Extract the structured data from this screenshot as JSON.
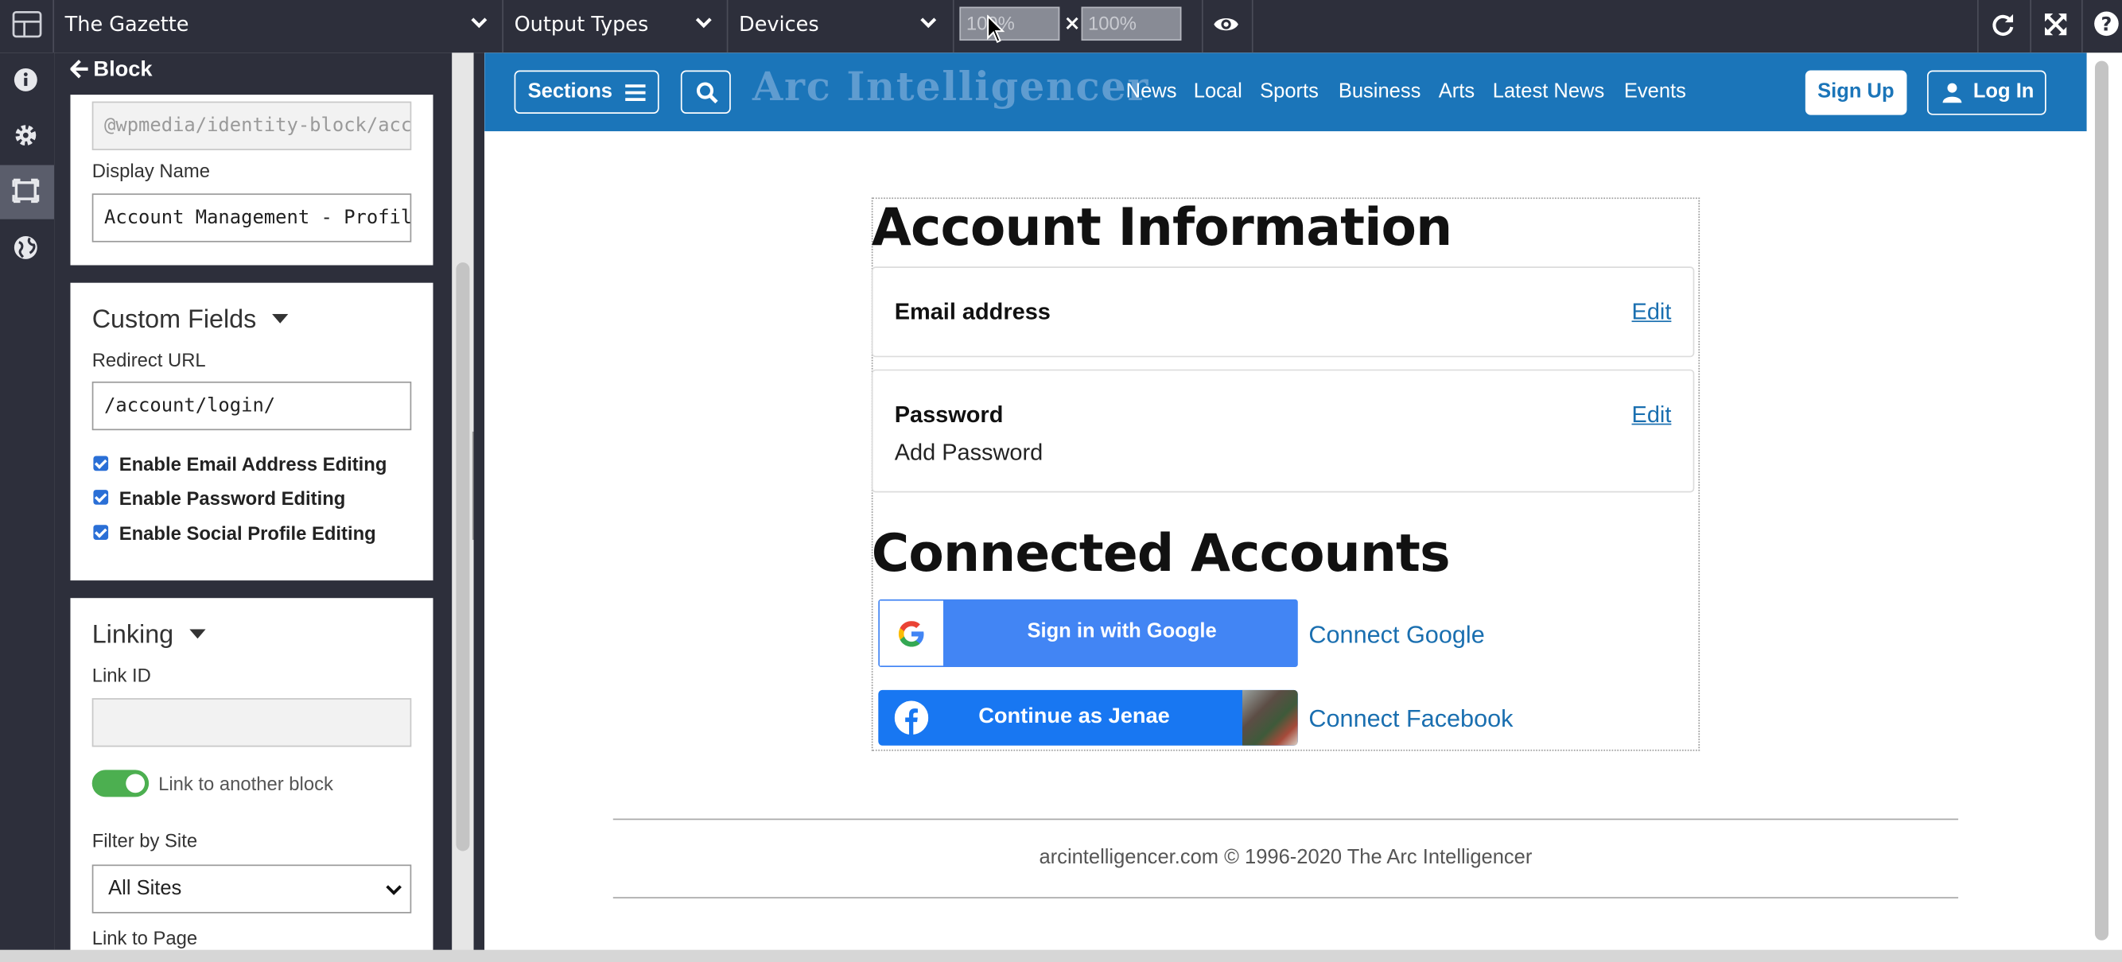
{
  "toolbar": {
    "site_select": "The Gazette",
    "output_types_select": "Output Types",
    "devices_select": "Devices",
    "width_value": "100%",
    "height_value": "100%",
    "times_sign": "×"
  },
  "panel": {
    "back_label": "Block",
    "fingerprint_value": "@wpmedia/identity-block/account",
    "display_name_label": "Display Name",
    "display_name_value": "Account Management - Profile",
    "custom_fields_title": "Custom Fields",
    "redirect_url_label": "Redirect URL",
    "redirect_url_value": "/account/login/",
    "checkboxes": [
      {
        "label": "Enable Email Address Editing",
        "checked": true
      },
      {
        "label": "Enable Password Editing",
        "checked": true
      },
      {
        "label": "Enable Social Profile Editing",
        "checked": true
      }
    ],
    "linking_title": "Linking",
    "link_id_label": "Link ID",
    "link_id_value": "",
    "link_toggle_label": "Link to another block",
    "filter_site_label": "Filter by Site",
    "filter_site_value": "All Sites",
    "link_to_page_label": "Link to Page"
  },
  "site": {
    "sections_label": "Sections",
    "logo_text": "Arc Intelligencer",
    "nav": [
      "News",
      "Local",
      "Sports",
      "Business",
      "Arts",
      "Latest News",
      "Events"
    ],
    "signup_label": "Sign Up",
    "login_label": "Log In"
  },
  "account": {
    "title": "Account Information",
    "email_label": "Email address",
    "email_edit": "Edit",
    "password_label": "Password",
    "password_edit": "Edit",
    "password_value": "Add Password",
    "connected_title": "Connected Accounts",
    "google_button": "Sign in with Google",
    "connect_google": "Connect Google",
    "facebook_button": "Continue as Jenae",
    "connect_facebook": "Connect Facebook"
  },
  "footer": {
    "copyright": "arcintelligencer.com © 1996-2020 The Arc Intelligencer"
  },
  "colors": {
    "toolbar_bg": "#2d2f3b",
    "site_header_bg": "#1b75b9",
    "google_blue": "#4285f4",
    "facebook_blue": "#1877f2",
    "link_blue": "#1a6fb0",
    "toggle_green": "#4caf50"
  }
}
